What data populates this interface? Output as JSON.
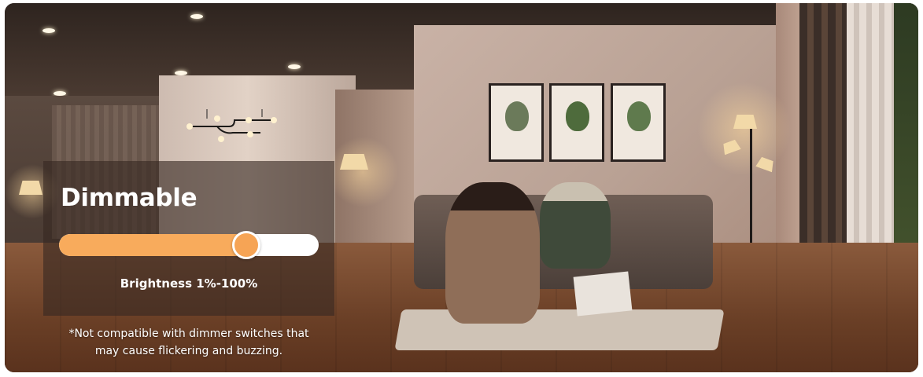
{
  "feature": {
    "title": "Dimmable",
    "brightness_label": "Brightness 1%-100%",
    "slider_level_fraction": 0.72,
    "accent_color": "#f8ab5c"
  },
  "note": {
    "line1": "*Not compatible with dimmer switches that",
    "line2": "may cause flickering and buzzing."
  }
}
